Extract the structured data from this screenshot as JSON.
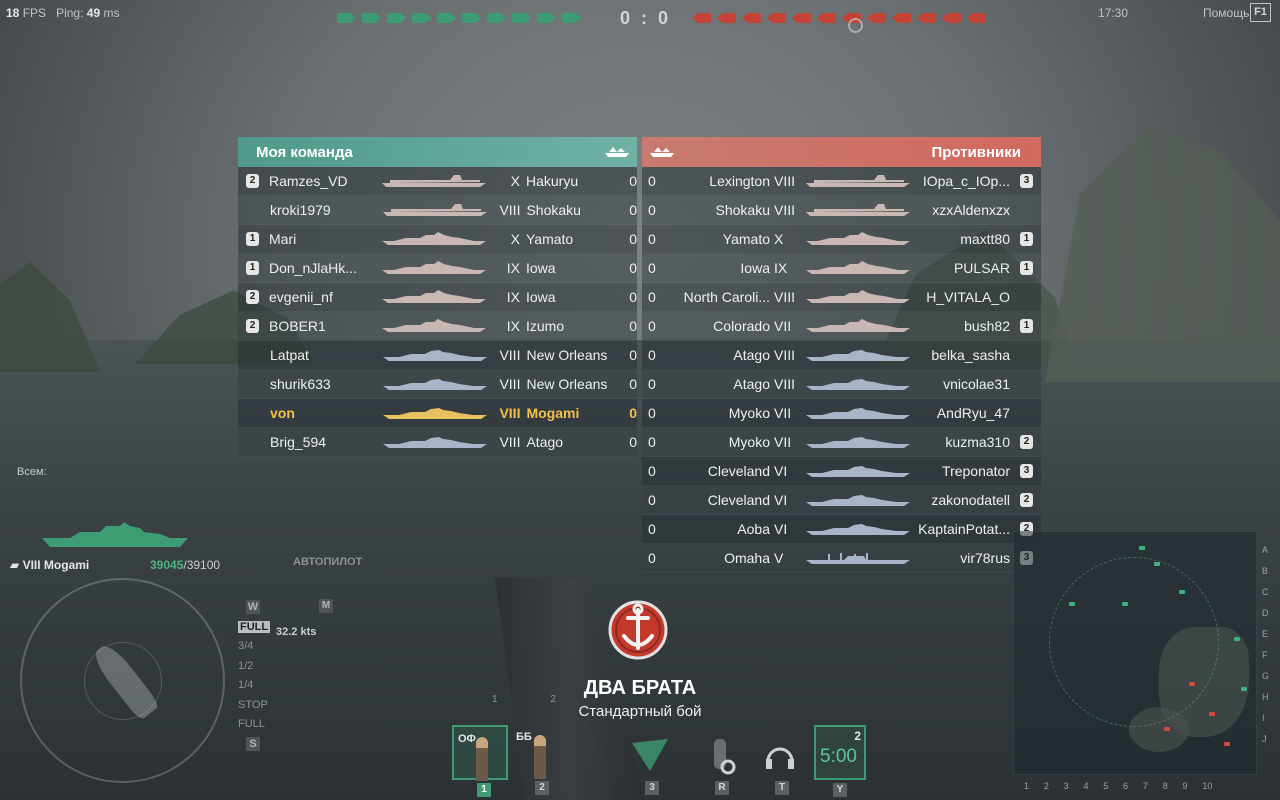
{
  "hud": {
    "fps_value": "18",
    "fps_label": "FPS",
    "ping_label": "Ping:",
    "ping_value": "49",
    "ping_unit": "ms",
    "score": "0 : 0",
    "clock": "17:30",
    "help_label": "Помощь",
    "help_key": "F1"
  },
  "colors": {
    "ally": "#3d9c74",
    "enemy": "#c34437",
    "self": "#f2c14a"
  },
  "ally_team": {
    "title": "Моя команда",
    "icon": "ships-icon",
    "rows": [
      {
        "division": "2",
        "player": "Ramzes_VD",
        "tier": "X",
        "ship": "Hakuryu",
        "frags": "0",
        "class": "cv"
      },
      {
        "division": "",
        "player": "kroki1979",
        "tier": "VIII",
        "ship": "Shokaku",
        "frags": "0",
        "class": "cv"
      },
      {
        "division": "1",
        "player": "Mari",
        "tier": "X",
        "ship": "Yamato",
        "frags": "0",
        "class": "bb"
      },
      {
        "division": "1",
        "player": "Don_nJlaHk...",
        "tier": "IX",
        "ship": "Iowa",
        "frags": "0",
        "class": "bb"
      },
      {
        "division": "2",
        "player": "evgenii_nf",
        "tier": "IX",
        "ship": "Iowa",
        "frags": "0",
        "class": "bb"
      },
      {
        "division": "2",
        "player": "BOBER1",
        "tier": "IX",
        "ship": "Izumo",
        "frags": "0",
        "class": "bb"
      },
      {
        "division": "",
        "player": "Latpat",
        "tier": "VIII",
        "ship": "New Orleans",
        "frags": "0",
        "class": "ca"
      },
      {
        "division": "",
        "player": "shurik633",
        "tier": "VIII",
        "ship": "New Orleans",
        "frags": "0",
        "class": "ca"
      },
      {
        "division": "",
        "player": "von",
        "tier": "VIII",
        "ship": "Mogami",
        "frags": "0",
        "class": "ca",
        "self": true
      },
      {
        "division": "",
        "player": "Brig_594",
        "tier": "VIII",
        "ship": "Atago",
        "frags": "0",
        "class": "ca"
      }
    ]
  },
  "enemy_team": {
    "title": "Противники",
    "icon": "ships-icon",
    "rows": [
      {
        "frags": "0",
        "ship": "Lexington",
        "tier": "VIII",
        "player": "IOpa_c_IOp...",
        "division": "3",
        "class": "cv"
      },
      {
        "frags": "0",
        "ship": "Shokaku",
        "tier": "VIII",
        "player": "xzxAldenxzx",
        "division": "",
        "class": "cv"
      },
      {
        "frags": "0",
        "ship": "Yamato",
        "tier": "X",
        "player": "maxtt80",
        "division": "1",
        "class": "bb"
      },
      {
        "frags": "0",
        "ship": "Iowa",
        "tier": "IX",
        "player": "PULSAR",
        "division": "1",
        "class": "bb"
      },
      {
        "frags": "0",
        "ship": "North Caroli...",
        "tier": "VIII",
        "player": "H_VITALA_O",
        "division": "",
        "class": "bb"
      },
      {
        "frags": "0",
        "ship": "Colorado",
        "tier": "VII",
        "player": "bush82",
        "division": "1",
        "class": "bb"
      },
      {
        "frags": "0",
        "ship": "Atago",
        "tier": "VIII",
        "player": "belka_sasha",
        "division": "",
        "class": "ca"
      },
      {
        "frags": "0",
        "ship": "Atago",
        "tier": "VIII",
        "player": "vnicolae31",
        "division": "",
        "class": "ca"
      },
      {
        "frags": "0",
        "ship": "Myoko",
        "tier": "VII",
        "player": "AndRyu_47",
        "division": "",
        "class": "ca"
      },
      {
        "frags": "0",
        "ship": "Myoko",
        "tier": "VII",
        "player": "kuzma310",
        "division": "2",
        "class": "ca"
      },
      {
        "frags": "0",
        "ship": "Cleveland",
        "tier": "VI",
        "player": "Treponator",
        "division": "3",
        "class": "ca"
      },
      {
        "frags": "0",
        "ship": "Cleveland",
        "tier": "VI",
        "player": "zakonodatell",
        "division": "2",
        "class": "ca"
      },
      {
        "frags": "0",
        "ship": "Aoba",
        "tier": "VI",
        "player": "KaptainPotat...",
        "division": "2",
        "class": "ca"
      },
      {
        "frags": "0",
        "ship": "Omaha",
        "tier": "V",
        "player": "vir78rus",
        "division": "3",
        "class": "cl"
      }
    ]
  },
  "own_ship": {
    "name": "VIII Mogami",
    "hp_current": "39045",
    "hp_max": "/39100",
    "chat_label": "Всем:",
    "autopilot_label": "АВТОПИЛОТ",
    "autopilot_key": "M",
    "speed": "32.2 kts",
    "speed_key_up": "W",
    "speed_key_down": "S",
    "speed_levels": [
      "FULL",
      "3/4",
      "1/2",
      "1/4",
      "STOP",
      "FULL"
    ],
    "speed_selected": "FULL"
  },
  "loading": {
    "map_name": "ДВА БРАТА",
    "mode": "Стандартный бой",
    "emblem": "anchor-emblem-icon"
  },
  "consumables": {
    "weapon_group_1": "1",
    "weapon_group_2": "2",
    "slots": [
      {
        "label": "ОФ",
        "key": "1",
        "icon": "he-shell-icon"
      },
      {
        "label": "ББ",
        "key": "2",
        "icon": "ap-shell-icon"
      },
      {
        "label": "",
        "key": "3",
        "icon": "torpedo-icon"
      },
      {
        "label": "",
        "key": "R",
        "icon": "repair-party-icon"
      },
      {
        "label": "",
        "key": "T",
        "icon": "hydroacoustic-icon"
      }
    ],
    "timer": {
      "value": "5:00",
      "count": "2",
      "key": "Y"
    }
  },
  "minimap": {
    "letters": [
      "A",
      "B",
      "C",
      "D",
      "E",
      "F",
      "G",
      "H",
      "I",
      "J"
    ],
    "numbers": [
      "1",
      "2",
      "3",
      "4",
      "5",
      "6",
      "7",
      "8",
      "9",
      "10"
    ]
  }
}
